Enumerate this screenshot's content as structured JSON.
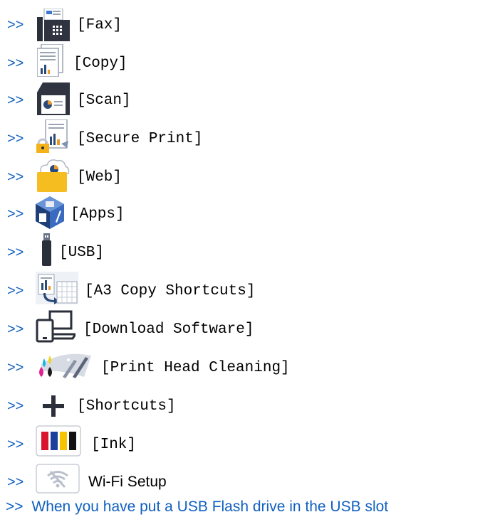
{
  "items": [
    {
      "arrow": ">>",
      "label": "[Fax]",
      "icon": "fax-icon"
    },
    {
      "arrow": ">>",
      "label": "[Copy]",
      "icon": "copy-icon"
    },
    {
      "arrow": ">>",
      "label": "[Scan]",
      "icon": "scan-icon"
    },
    {
      "arrow": ">>",
      "label": "[Secure Print]",
      "icon": "secure-print-icon"
    },
    {
      "arrow": ">>",
      "label": "[Web]",
      "icon": "web-icon"
    },
    {
      "arrow": ">>",
      "label": "[Apps]",
      "icon": "apps-icon"
    },
    {
      "arrow": ">>",
      "label": "[USB]",
      "icon": "usb-icon"
    },
    {
      "arrow": ">>",
      "label": "[A3 Copy Shortcuts]",
      "icon": "a3-copy-shortcuts-icon"
    },
    {
      "arrow": ">>",
      "label": "[Download Software]",
      "icon": "download-software-icon"
    },
    {
      "arrow": ">>",
      "label": "[Print Head Cleaning]",
      "icon": "print-head-cleaning-icon"
    },
    {
      "arrow": ">>",
      "label": "[Shortcuts]",
      "icon": "plus-icon"
    },
    {
      "arrow": ">>",
      "label": "[Ink]",
      "icon": "ink-icon"
    },
    {
      "arrow": ">>",
      "label": "Wi-Fi Setup",
      "icon": "wifi-icon"
    },
    {
      "arrow": ">>",
      "label": "When you have put a USB Flash drive in the USB slot",
      "icon": ""
    }
  ],
  "colors": {
    "link": "#1060c0",
    "arrow": "#1060c0"
  }
}
